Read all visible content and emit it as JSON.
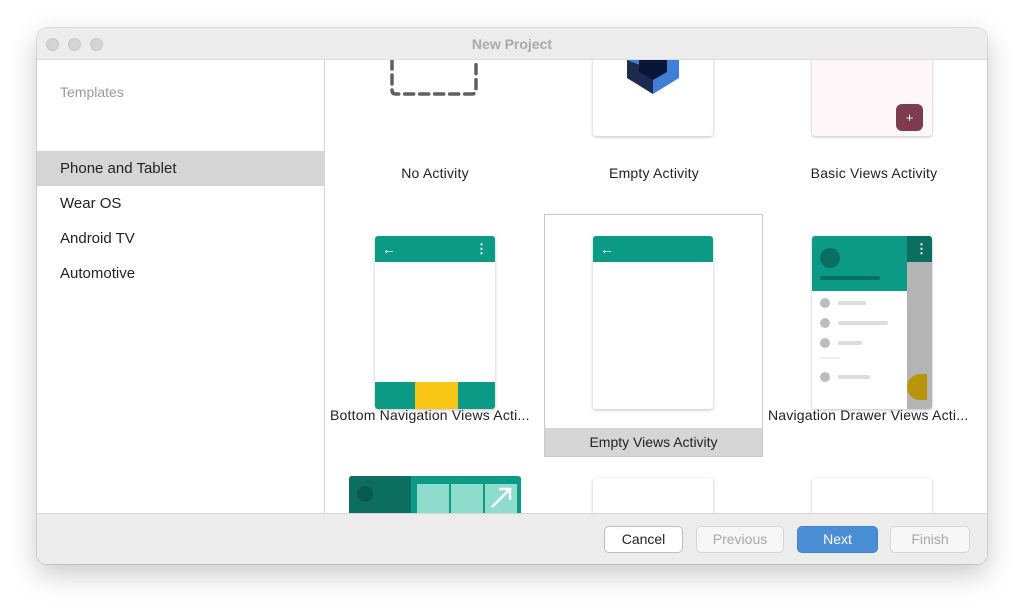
{
  "window": {
    "title": "New Project"
  },
  "sidebar": {
    "header": "Templates",
    "items": [
      {
        "label": "Phone and Tablet",
        "selected": true
      },
      {
        "label": "Wear OS",
        "selected": false
      },
      {
        "label": "Android TV",
        "selected": false
      },
      {
        "label": "Automotive",
        "selected": false
      }
    ]
  },
  "templates": {
    "no_activity": "No Activity",
    "empty_activity": "Empty Activity",
    "basic_views_activity": "Basic Views Activity",
    "bottom_navigation": "Bottom Navigation Views Acti...",
    "empty_views_activity": "Empty Views Activity",
    "navigation_drawer": "Navigation Drawer Views Acti...",
    "selected": "Empty Views Activity"
  },
  "icons": {
    "back": "←",
    "overflow": "⋮",
    "plus": "+"
  },
  "colors": {
    "teal": "#0b9a86",
    "dark_teal": "#0b6e60",
    "yellow": "#f8c514",
    "primary_button": "#4a8fd6",
    "maroon_fab": "#7d3b4f"
  },
  "footer": {
    "cancel": "Cancel",
    "previous": "Previous",
    "next": "Next",
    "finish": "Finish"
  }
}
